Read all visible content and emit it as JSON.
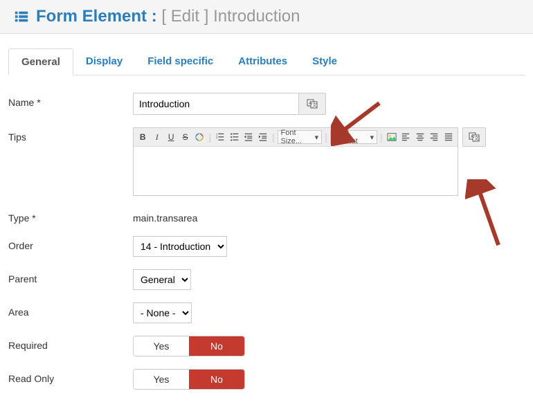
{
  "header": {
    "title_prefix": "Form Element :",
    "title_mode": "[ Edit ]",
    "title_name": "Introduction"
  },
  "tabs": [
    {
      "label": "General",
      "active": true
    },
    {
      "label": "Display",
      "active": false
    },
    {
      "label": "Field specific",
      "active": false
    },
    {
      "label": "Attributes",
      "active": false
    },
    {
      "label": "Style",
      "active": false
    }
  ],
  "fields": {
    "name": {
      "label": "Name *",
      "value": "Introduction"
    },
    "tips": {
      "label": "Tips"
    },
    "type": {
      "label": "Type *",
      "value": "main.transarea"
    },
    "order": {
      "label": "Order",
      "value": "14 - Introduction"
    },
    "parent": {
      "label": "Parent",
      "value": "General"
    },
    "area": {
      "label": "Area",
      "value": "- None -"
    },
    "required": {
      "label": "Required",
      "yes": "Yes",
      "no": "No",
      "value": false
    },
    "readonly": {
      "label": "Read Only",
      "yes": "Yes",
      "no": "No",
      "value": false
    }
  },
  "editor": {
    "fontsize_label": "Font Size...",
    "fontformat_label": "Font Format"
  }
}
